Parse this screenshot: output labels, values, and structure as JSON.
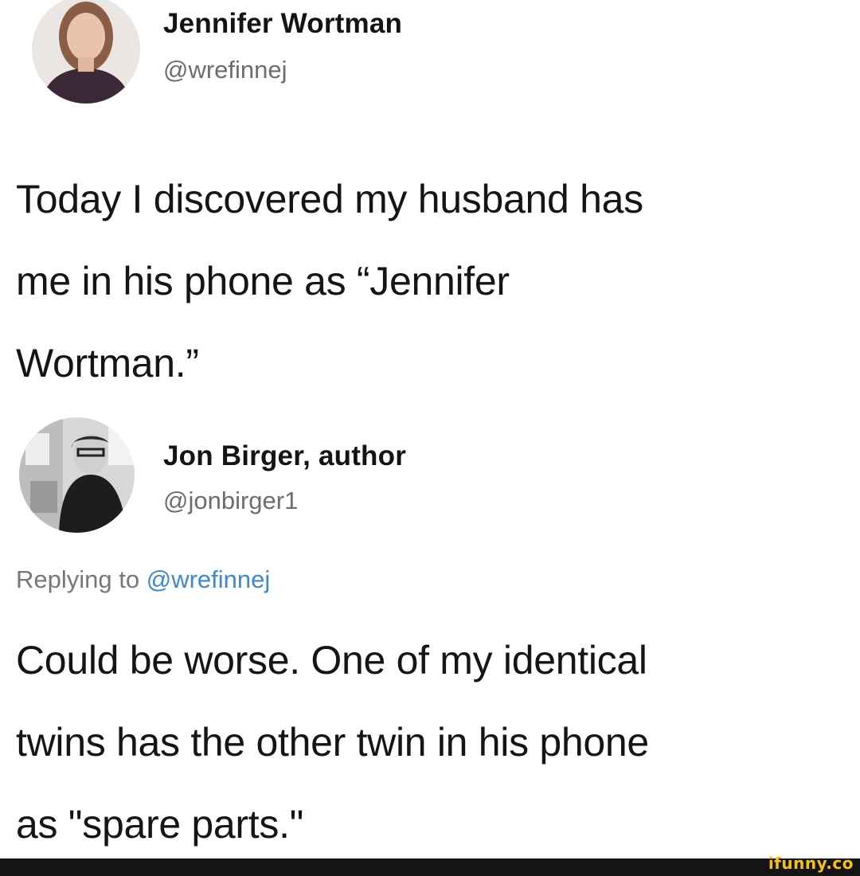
{
  "tweet": {
    "author_name": "Jennifer Wortman",
    "author_handle": "@wrefinnej",
    "lines": [
      "Today I discovered my husband has",
      "me in his phone as “Jennifer",
      "Wortman.”"
    ]
  },
  "reply": {
    "author_name": "Jon Birger, author",
    "author_handle": "@jonbirger1",
    "replying_prefix": "Replying to",
    "replying_mention": "@wrefinnej",
    "lines": [
      "Could be worse. One of my identical",
      "twins has the other twin in his phone",
      "as \"spare parts.\""
    ]
  },
  "watermark": "ifunny.co",
  "colors": {
    "mention": "#3f88c9",
    "handle": "#6d6d6d",
    "watermark": "#f4c11a",
    "footer": "#141414"
  }
}
